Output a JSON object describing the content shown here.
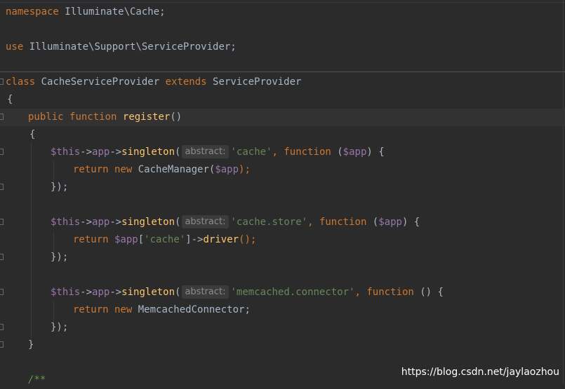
{
  "editor": {
    "line1": {
      "kw": "namespace",
      "text": " Illuminate\\Cache;"
    },
    "line2": {
      "kw": "use",
      "text": " Illuminate\\Support\\ServiceProvider;"
    },
    "line3": {
      "kw1": "class",
      "name": " CacheServiceProvider ",
      "kw2": "extends",
      "parent": " ServiceProvider"
    },
    "line4": "{",
    "line5": {
      "kw1": "public",
      "kw2": "function",
      "fn": "register",
      "rest": "()"
    },
    "line6": "{",
    "block1": {
      "this": "$this",
      "arrow1": "->",
      "app": "app",
      "arrow2": "->",
      "method": "singleton",
      "open": "(",
      "hint": "abstract:",
      "str": "'cache'",
      "comma": ", ",
      "fnkw": "function",
      "params_open": " (",
      "param": "$app",
      "params_close": ") {",
      "ret_kw": "return",
      "new_kw": " new",
      "ret_text": " CacheManager(",
      "ret_var": "$app",
      "ret_end": ");",
      "close": "});"
    },
    "block2": {
      "this": "$this",
      "arrow1": "->",
      "app": "app",
      "arrow2": "->",
      "method": "singleton",
      "open": "(",
      "hint": "abstract:",
      "str": "'cache.store'",
      "comma": ", ",
      "fnkw": "function",
      "params_open": " (",
      "param": "$app",
      "params_close": ") {",
      "ret_kw": "return",
      "ret_var": " $app",
      "ret_bracket": "[",
      "ret_str": "'cache'",
      "ret_arrow": "]->",
      "ret_fn": "driver",
      "ret_end": "();",
      "close": "});"
    },
    "block3": {
      "this": "$this",
      "arrow1": "->",
      "app": "app",
      "arrow2": "->",
      "method": "singleton",
      "open": "(",
      "hint": "abstract:",
      "str": "'memcached.connector'",
      "comma": ", ",
      "fnkw": "function",
      "params": " () {",
      "ret_kw": "return",
      "new_kw": " new",
      "ret_text": " MemcachedConnector;",
      "close": "});"
    },
    "close_method": "}",
    "doc_comment": "/**"
  },
  "watermark": "https://blog.csdn.net/jaylaozhou"
}
